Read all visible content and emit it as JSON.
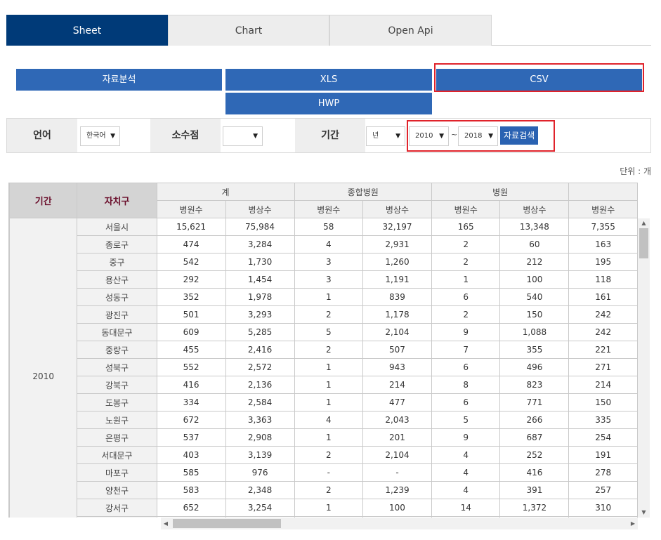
{
  "tabs": [
    {
      "label": "Sheet",
      "active": true
    },
    {
      "label": "Chart",
      "active": false
    },
    {
      "label": "Open Api",
      "active": false
    }
  ],
  "actions": {
    "analysis": "자료분석",
    "xls": "XLS",
    "csv": "CSV",
    "hwp": "HWP"
  },
  "filters": {
    "language_label": "언어",
    "language_value": "한국어",
    "decimal_label": "소수점",
    "decimal_value": "",
    "period_label": "기간",
    "period_unit": "년",
    "from_year": "2010",
    "range_sep": "~",
    "to_year": "2018",
    "search_label": "자료검색"
  },
  "unit_text": "단위 : 개",
  "table": {
    "col_period": "기간",
    "col_district": "자치구",
    "groups": [
      "계",
      "종합병원",
      "병원",
      ""
    ],
    "sub_headers": [
      "병원수",
      "병상수",
      "병원수",
      "병상수",
      "병원수",
      "병상수",
      "병원수"
    ],
    "period_value": "2010",
    "rows": [
      {
        "district": "서울시",
        "values": [
          "15,621",
          "75,984",
          "58",
          "32,197",
          "165",
          "13,348",
          "7,355"
        ]
      },
      {
        "district": "종로구",
        "values": [
          "474",
          "3,284",
          "4",
          "2,931",
          "2",
          "60",
          "163"
        ]
      },
      {
        "district": "중구",
        "values": [
          "542",
          "1,730",
          "3",
          "1,260",
          "2",
          "212",
          "195"
        ]
      },
      {
        "district": "용산구",
        "values": [
          "292",
          "1,454",
          "3",
          "1,191",
          "1",
          "100",
          "118"
        ]
      },
      {
        "district": "성동구",
        "values": [
          "352",
          "1,978",
          "1",
          "839",
          "6",
          "540",
          "161"
        ]
      },
      {
        "district": "광진구",
        "values": [
          "501",
          "3,293",
          "2",
          "1,178",
          "2",
          "150",
          "242"
        ]
      },
      {
        "district": "동대문구",
        "values": [
          "609",
          "5,285",
          "5",
          "2,104",
          "9",
          "1,088",
          "242"
        ]
      },
      {
        "district": "중랑구",
        "values": [
          "455",
          "2,416",
          "2",
          "507",
          "7",
          "355",
          "221"
        ]
      },
      {
        "district": "성북구",
        "values": [
          "552",
          "2,572",
          "1",
          "943",
          "6",
          "496",
          "271"
        ]
      },
      {
        "district": "강북구",
        "values": [
          "416",
          "2,136",
          "1",
          "214",
          "8",
          "823",
          "214"
        ]
      },
      {
        "district": "도봉구",
        "values": [
          "334",
          "2,584",
          "1",
          "477",
          "6",
          "771",
          "150"
        ]
      },
      {
        "district": "노원구",
        "values": [
          "672",
          "3,363",
          "4",
          "2,043",
          "5",
          "266",
          "335"
        ]
      },
      {
        "district": "은평구",
        "values": [
          "537",
          "2,908",
          "1",
          "201",
          "9",
          "687",
          "254"
        ]
      },
      {
        "district": "서대문구",
        "values": [
          "403",
          "3,139",
          "2",
          "2,104",
          "4",
          "252",
          "191"
        ]
      },
      {
        "district": "마포구",
        "values": [
          "585",
          "976",
          "-",
          "-",
          "4",
          "416",
          "278"
        ]
      },
      {
        "district": "양천구",
        "values": [
          "583",
          "2,348",
          "2",
          "1,239",
          "4",
          "391",
          "257"
        ]
      },
      {
        "district": "강서구",
        "values": [
          "652",
          "3,254",
          "1",
          "100",
          "14",
          "1,372",
          "310"
        ]
      }
    ]
  },
  "icons": {
    "dropdown": "caret-down-icon",
    "scroll_up": "arrow-up-icon",
    "scroll_down": "arrow-down-icon",
    "scroll_left": "arrow-left-icon",
    "scroll_right": "arrow-right-icon"
  },
  "colors": {
    "tab_active": "#003a78",
    "button_blue": "#2f68b6",
    "highlight_red": "#e0232b",
    "header_text": "#6b0f2c"
  }
}
